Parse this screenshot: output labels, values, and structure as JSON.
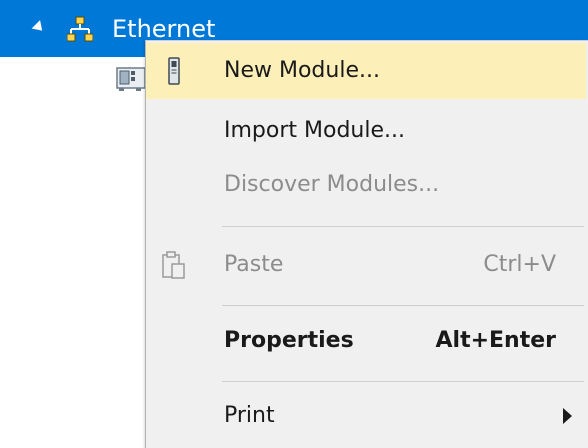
{
  "tree": {
    "selected_node_label": "Ethernet",
    "colors": {
      "selection_bg": "#0078d7",
      "selection_text": "#ffffff"
    },
    "icons": {
      "expander": "expanded-triangle-icon",
      "node": "network-topology-icon",
      "child": "ethernet-module-icon"
    }
  },
  "context_menu": {
    "items": [
      {
        "label": "New Module...",
        "icon": "module-icon",
        "state": "highlighted"
      },
      {
        "label": "Import Module...",
        "state": "enabled"
      },
      {
        "label": "Discover Modules...",
        "state": "disabled"
      },
      {
        "label": "Paste",
        "shortcut": "Ctrl+V",
        "icon": "paste-clipboard-icon",
        "state": "disabled"
      },
      {
        "label": "Properties",
        "shortcut": "Alt+Enter",
        "state": "default-bold"
      },
      {
        "label": "Print",
        "icon": "submenu-arrow-icon",
        "state": "enabled"
      }
    ],
    "colors": {
      "background": "#f0f0f0",
      "highlight": "#fcefb8",
      "disabled_text": "#8c8c8c",
      "text": "#1a1a1a"
    }
  }
}
